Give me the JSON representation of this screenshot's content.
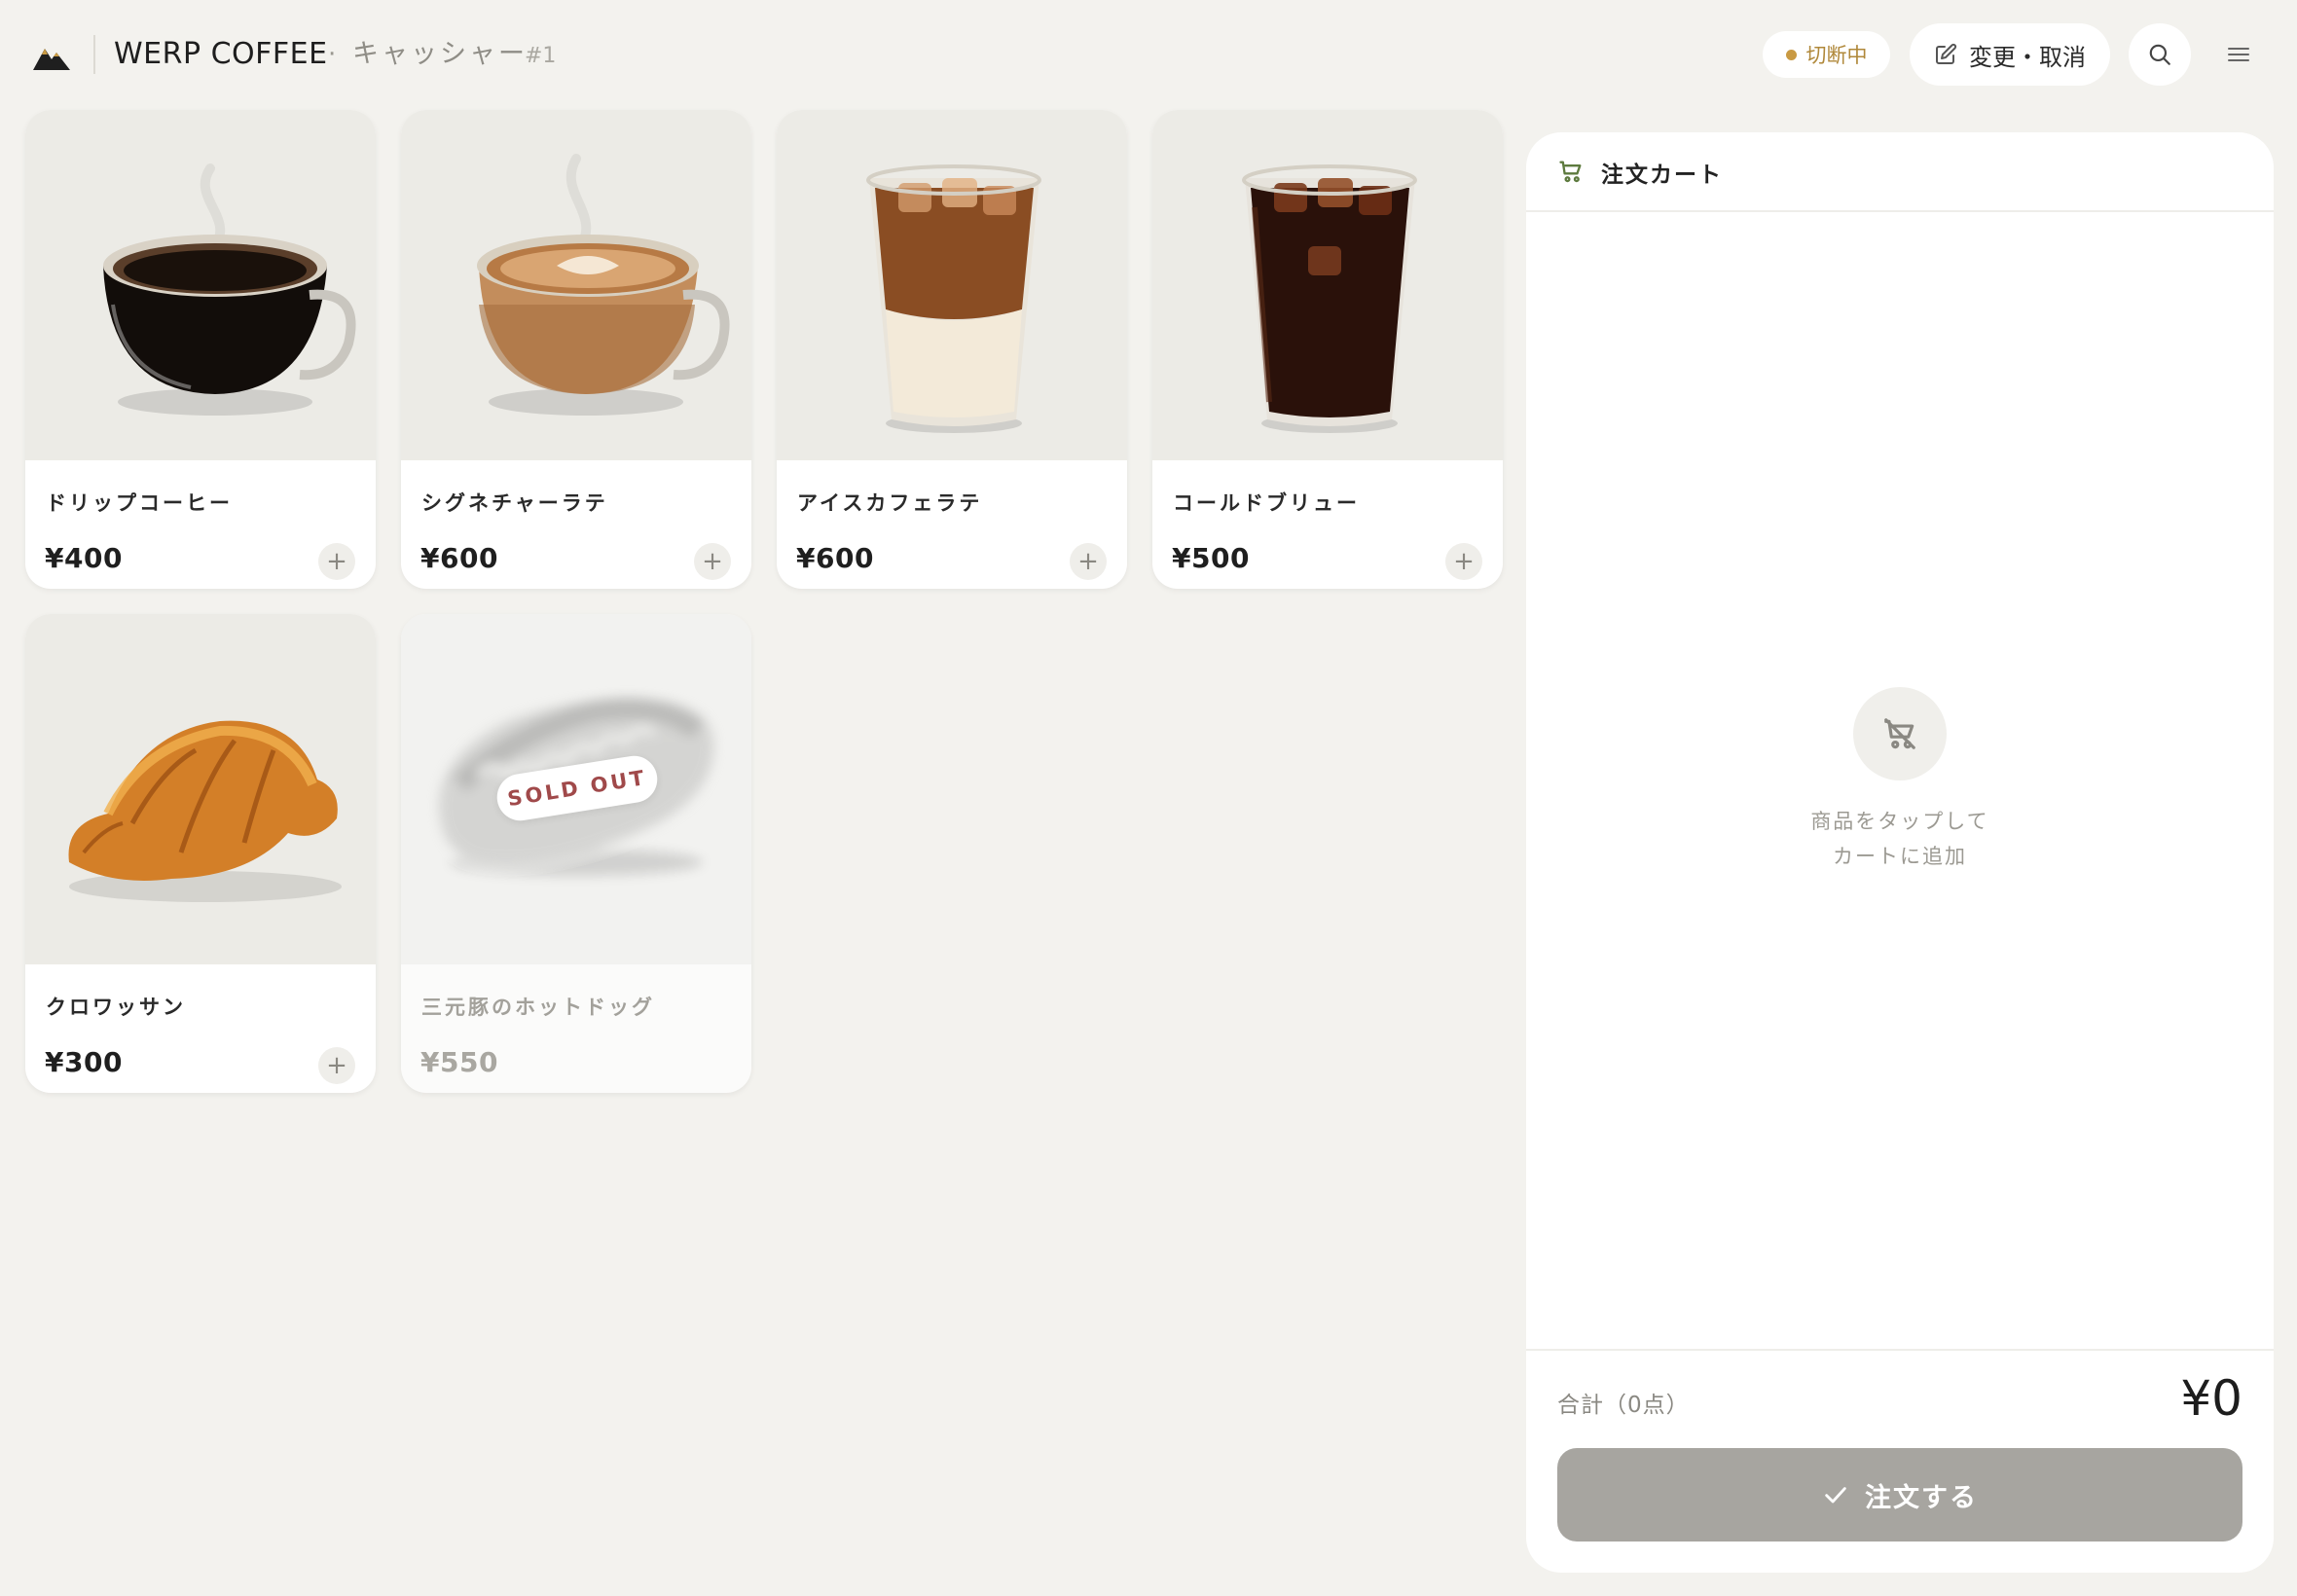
{
  "header": {
    "brand": "WERP COFFEE",
    "separator": "·",
    "subtitle": "キャッシャー",
    "register": "#1",
    "status": "切断中",
    "edit_label": "変更・取消"
  },
  "colors": {
    "background": "#f3f2ee",
    "status_accent": "#c99a43",
    "sold_out_text": "#a0494a",
    "order_button_disabled": "#a7a5a0",
    "cart_icon": "#5d7a3e"
  },
  "products": [
    {
      "name": "ドリップコーヒー",
      "price": "¥400",
      "image": "hot-black-coffee-cup",
      "sold_out": false
    },
    {
      "name": "シグネチャーラテ",
      "price": "¥600",
      "image": "latte-cup",
      "sold_out": false
    },
    {
      "name": "アイスカフェラテ",
      "price": "¥600",
      "image": "iced-latte-glass",
      "sold_out": false
    },
    {
      "name": "コールドブリュー",
      "price": "¥500",
      "image": "iced-cold-brew-glass",
      "sold_out": false
    },
    {
      "name": "クロワッサン",
      "price": "¥300",
      "image": "croissant",
      "sold_out": false
    },
    {
      "name": "三元豚のホットドッグ",
      "price": "¥550",
      "image": "hot-dog",
      "sold_out": true
    }
  ],
  "add_symbol": "+",
  "sold_out_label": "SOLD OUT",
  "cart": {
    "title": "注文カート",
    "empty_line1": "商品をタップして",
    "empty_line2": "カートに追加",
    "total_label": "合計（0点）",
    "total_value": "¥0",
    "order_label": "注文する"
  }
}
